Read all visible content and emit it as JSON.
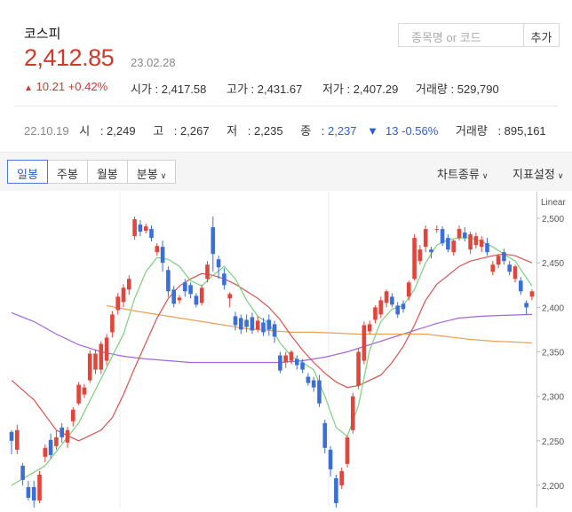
{
  "header": {
    "name": "코스피",
    "price": "2,412.85",
    "date": "23.02.28",
    "change_arrow": "▲",
    "change": "10.21 +0.42%",
    "stats": {
      "open_label": "시가",
      "open": "2,417.58",
      "high_label": "고가",
      "high": "2,431.67",
      "low_label": "저가",
      "low": "2,407.29",
      "volume_label": "거래량",
      "volume": "529,790"
    }
  },
  "search": {
    "placeholder": "종목명 or 코드",
    "add_label": "추가"
  },
  "prev": {
    "date": "22.10.19",
    "open_label": "시",
    "open": "2,249",
    "high_label": "고",
    "high": "2,267",
    "low_label": "저",
    "low": "2,235",
    "close_label": "종",
    "close": "2,237",
    "change_arrow": "▼",
    "change": "13 -0.56%",
    "volume_label": "거래량",
    "volume": "895,161"
  },
  "toolbar": {
    "tabs": [
      "일봉",
      "주봉",
      "월봉",
      "분봉"
    ],
    "active_tab": 0,
    "chart_type_label": "차트종류",
    "indicator_label": "지표설정"
  },
  "colors": {
    "up": "#e0463c",
    "down": "#3a6fd8",
    "accent": "#2d5ed6"
  },
  "chart_data": {
    "type": "candlestick",
    "scale_label": "Linear",
    "ylim": [
      2175,
      2530
    ],
    "y_ticks": [
      2200,
      2250,
      2300,
      2350,
      2400,
      2450,
      2500
    ],
    "candles": [
      [
        2260,
        2250,
        2262,
        2235
      ],
      [
        2240,
        2262,
        2268,
        2235
      ],
      [
        2222,
        2206,
        2225,
        2200
      ],
      [
        2198,
        2186,
        2205,
        2183
      ],
      [
        2198,
        2183,
        2205,
        2175
      ],
      [
        2183,
        2212,
        2216,
        2180
      ],
      [
        2232,
        2242,
        2246,
        2226
      ],
      [
        2251,
        2234,
        2258,
        2230
      ],
      [
        2244,
        2254,
        2262,
        2240
      ],
      [
        2265,
        2254,
        2270,
        2248
      ],
      [
        2248,
        2262,
        2266,
        2242
      ],
      [
        2272,
        2285,
        2288,
        2266
      ],
      [
        2292,
        2313,
        2316,
        2290
      ],
      [
        2302,
        2310,
        2314,
        2298
      ],
      [
        2318,
        2348,
        2352,
        2315
      ],
      [
        2330,
        2348,
        2352,
        2325
      ],
      [
        2330,
        2359,
        2362,
        2325
      ],
      [
        2340,
        2366,
        2370,
        2335
      ],
      [
        2372,
        2392,
        2396,
        2366
      ],
      [
        2397,
        2412,
        2416,
        2392
      ],
      [
        2406,
        2422,
        2426,
        2400
      ],
      [
        2420,
        2432,
        2436,
        2414
      ],
      [
        2480,
        2499,
        2502,
        2476
      ],
      [
        2493,
        2485,
        2498,
        2480
      ],
      [
        2486,
        2491,
        2494,
        2483
      ],
      [
        2488,
        2478,
        2492,
        2474
      ],
      [
        2462,
        2469,
        2472,
        2458
      ],
      [
        2468,
        2450,
        2475,
        2440
      ],
      [
        2442,
        2418,
        2446,
        2412
      ],
      [
        2420,
        2404,
        2424,
        2400
      ],
      [
        2408,
        2411,
        2414,
        2404
      ],
      [
        2428,
        2418,
        2432,
        2412
      ],
      [
        2425,
        2415,
        2428,
        2410
      ],
      [
        2413,
        2403,
        2416,
        2400
      ],
      [
        2405,
        2422,
        2425,
        2402
      ],
      [
        2432,
        2448,
        2452,
        2428
      ],
      [
        2490,
        2460,
        2502,
        2440
      ],
      [
        2454,
        2445,
        2458,
        2432
      ],
      [
        2438,
        2425,
        2444,
        2420
      ],
      [
        2410,
        2415,
        2417,
        2400
      ],
      [
        2390,
        2380,
        2395,
        2374
      ],
      [
        2388,
        2375,
        2392,
        2370
      ],
      [
        2386,
        2378,
        2392,
        2372
      ],
      [
        2389,
        2374,
        2394,
        2370
      ],
      [
        2375,
        2385,
        2390,
        2372
      ],
      [
        2383,
        2372,
        2388,
        2368
      ],
      [
        2386,
        2375,
        2392,
        2368
      ],
      [
        2381,
        2367,
        2385,
        2360
      ],
      [
        2346,
        2329,
        2350,
        2326
      ],
      [
        2338,
        2346,
        2350,
        2332
      ],
      [
        2340,
        2350,
        2352,
        2336
      ],
      [
        2342,
        2335,
        2346,
        2330
      ],
      [
        2338,
        2330,
        2342,
        2326
      ],
      [
        2322,
        2315,
        2326,
        2312
      ],
      [
        2318,
        2310,
        2322,
        2305
      ],
      [
        2318,
        2292,
        2324,
        2288
      ],
      [
        2270,
        2242,
        2274,
        2236
      ],
      [
        2240,
        2218,
        2244,
        2210
      ],
      [
        2208,
        2180,
        2212,
        2175
      ],
      [
        2200,
        2216,
        2220,
        2196
      ],
      [
        2224,
        2254,
        2256,
        2220
      ],
      [
        2262,
        2300,
        2304,
        2258
      ],
      [
        2312,
        2350,
        2354,
        2308
      ],
      [
        2340,
        2380,
        2384,
        2336
      ],
      [
        2373,
        2381,
        2385,
        2370
      ],
      [
        2386,
        2400,
        2402,
        2382
      ],
      [
        2392,
        2408,
        2412,
        2388
      ],
      [
        2405,
        2418,
        2420,
        2400
      ],
      [
        2412,
        2403,
        2416,
        2400
      ],
      [
        2402,
        2392,
        2406,
        2388
      ],
      [
        2404,
        2398,
        2408,
        2394
      ],
      [
        2412,
        2428,
        2430,
        2408
      ],
      [
        2432,
        2478,
        2482,
        2430
      ],
      [
        2452,
        2465,
        2470,
        2448
      ],
      [
        2468,
        2488,
        2492,
        2462
      ],
      [
        2465,
        2462,
        2468,
        2455
      ],
      [
        2488,
        2488,
        2492,
        2484
      ],
      [
        2488,
        2472,
        2491,
        2469
      ],
      [
        2478,
        2465,
        2482,
        2462
      ],
      [
        2462,
        2475,
        2476,
        2458
      ],
      [
        2478,
        2488,
        2492,
        2475
      ],
      [
        2484,
        2478,
        2490,
        2474
      ],
      [
        2465,
        2482,
        2485,
        2460
      ],
      [
        2470,
        2480,
        2484,
        2466
      ],
      [
        2468,
        2476,
        2480,
        2462
      ],
      [
        2472,
        2462,
        2478,
        2458
      ],
      [
        2440,
        2448,
        2452,
        2436
      ],
      [
        2448,
        2458,
        2460,
        2444
      ],
      [
        2462,
        2452,
        2466,
        2448
      ],
      [
        2448,
        2440,
        2452,
        2436
      ],
      [
        2432,
        2446,
        2448,
        2428
      ],
      [
        2430,
        2418,
        2434,
        2414
      ],
      [
        2405,
        2400,
        2408,
        2392
      ],
      [
        2412,
        2418,
        2420,
        2408
      ]
    ],
    "ma_green": [
      [
        0,
        2200
      ],
      [
        6,
        2222
      ],
      [
        12,
        2270
      ],
      [
        16,
        2320
      ],
      [
        20,
        2370
      ],
      [
        22,
        2410
      ],
      [
        24,
        2440
      ],
      [
        26,
        2456
      ],
      [
        28,
        2454
      ],
      [
        30,
        2446
      ],
      [
        32,
        2430
      ],
      [
        34,
        2424
      ],
      [
        36,
        2436
      ],
      [
        38,
        2446
      ],
      [
        40,
        2432
      ],
      [
        42,
        2408
      ],
      [
        44,
        2390
      ],
      [
        46,
        2382
      ],
      [
        48,
        2360
      ],
      [
        50,
        2345
      ],
      [
        52,
        2338
      ],
      [
        54,
        2330
      ],
      [
        56,
        2300
      ],
      [
        58,
        2265
      ],
      [
        60,
        2255
      ],
      [
        62,
        2290
      ],
      [
        64,
        2352
      ],
      [
        66,
        2384
      ],
      [
        68,
        2398
      ],
      [
        70,
        2402
      ],
      [
        72,
        2420
      ],
      [
        74,
        2450
      ],
      [
        76,
        2470
      ],
      [
        78,
        2476
      ],
      [
        80,
        2478
      ],
      [
        82,
        2478
      ],
      [
        84,
        2474
      ],
      [
        86,
        2468
      ],
      [
        88,
        2460
      ],
      [
        90,
        2452
      ],
      [
        93,
        2424
      ]
    ],
    "ma_red": [
      [
        0,
        2318
      ],
      [
        4,
        2296
      ],
      [
        8,
        2262
      ],
      [
        12,
        2250
      ],
      [
        16,
        2262
      ],
      [
        18,
        2276
      ],
      [
        20,
        2302
      ],
      [
        22,
        2332
      ],
      [
        24,
        2360
      ],
      [
        26,
        2388
      ],
      [
        28,
        2410
      ],
      [
        30,
        2424
      ],
      [
        32,
        2432
      ],
      [
        34,
        2438
      ],
      [
        36,
        2436
      ],
      [
        38,
        2432
      ],
      [
        40,
        2426
      ],
      [
        42,
        2418
      ],
      [
        44,
        2410
      ],
      [
        46,
        2400
      ],
      [
        48,
        2386
      ],
      [
        50,
        2368
      ],
      [
        52,
        2352
      ],
      [
        54,
        2338
      ],
      [
        56,
        2326
      ],
      [
        58,
        2316
      ],
      [
        60,
        2310
      ],
      [
        62,
        2312
      ],
      [
        64,
        2318
      ],
      [
        66,
        2324
      ],
      [
        68,
        2338
      ],
      [
        70,
        2356
      ],
      [
        72,
        2380
      ],
      [
        74,
        2408
      ],
      [
        76,
        2426
      ],
      [
        78,
        2436
      ],
      [
        80,
        2446
      ],
      [
        82,
        2452
      ],
      [
        84,
        2455
      ],
      [
        86,
        2458
      ],
      [
        88,
        2460
      ],
      [
        90,
        2458
      ],
      [
        93,
        2450
      ]
    ],
    "ma_orange": [
      [
        17,
        2402
      ],
      [
        22,
        2396
      ],
      [
        26,
        2392
      ],
      [
        30,
        2388
      ],
      [
        34,
        2384
      ],
      [
        38,
        2380
      ],
      [
        42,
        2376
      ],
      [
        46,
        2374
      ],
      [
        50,
        2372
      ],
      [
        54,
        2372
      ],
      [
        58,
        2371
      ],
      [
        62,
        2370
      ],
      [
        66,
        2370
      ],
      [
        70,
        2370
      ],
      [
        74,
        2370
      ],
      [
        78,
        2367
      ],
      [
        82,
        2364
      ],
      [
        86,
        2362
      ],
      [
        90,
        2361
      ],
      [
        93,
        2360
      ]
    ],
    "ma_purple": [
      [
        0,
        2394
      ],
      [
        4,
        2384
      ],
      [
        8,
        2370
      ],
      [
        12,
        2358
      ],
      [
        16,
        2350
      ],
      [
        20,
        2345
      ],
      [
        24,
        2342
      ],
      [
        28,
        2340
      ],
      [
        32,
        2338
      ],
      [
        36,
        2338
      ],
      [
        40,
        2338
      ],
      [
        44,
        2338
      ],
      [
        48,
        2338
      ],
      [
        52,
        2340
      ],
      [
        56,
        2344
      ],
      [
        60,
        2350
      ],
      [
        64,
        2358
      ],
      [
        68,
        2366
      ],
      [
        72,
        2374
      ],
      [
        76,
        2382
      ],
      [
        80,
        2388
      ],
      [
        84,
        2390
      ],
      [
        88,
        2391
      ],
      [
        93,
        2392
      ]
    ]
  }
}
